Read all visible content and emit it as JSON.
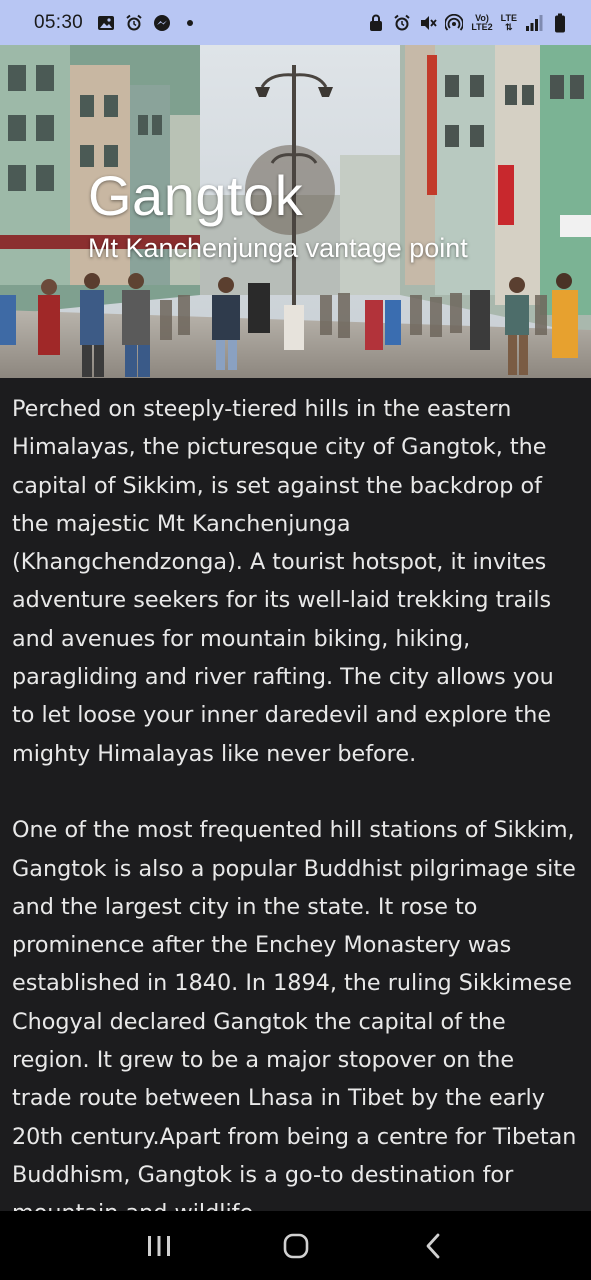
{
  "status_bar": {
    "time": "05:30",
    "left_icons": [
      "image-icon",
      "alarm-icon",
      "messenger-icon",
      "dot-icon"
    ],
    "network_label_top": "Vo)",
    "network_label_bottom": "LTE2",
    "lte_label": "LTE",
    "right_icons": [
      "lock-icon",
      "alarm-icon",
      "mute-icon",
      "hotspot-icon",
      "signal-icon",
      "battery-icon"
    ]
  },
  "hero": {
    "title": "Gangtok",
    "subtitle": "Mt Kanchenjunga vantage point",
    "image": "street-scene-photo"
  },
  "article": {
    "paragraphs": [
      "Perched on steeply-tiered hills in the eastern Himalayas, the picturesque city of Gangtok, the capital of Sikkim, is set against the backdrop of the majestic Mt Kanchenjunga (Khangchendzonga). A tourist hotspot, it invites adventure seekers for its well-laid trekking trails and avenues for mountain biking, hiking, paragliding and river rafting. The city allows you to let loose your inner daredevil and explore the mighty Himalayas like never before.",
      "One of the most frequented hill stations of Sikkim, Gangtok is also a popular Buddhist pilgrimage site and the largest city in the state. It rose to prominence after the Enchey Monastery was established in 1840. In 1894, the ruling Sikkimese Chogyal declared Gangtok the capital of the region. It grew to be a major stopover on the trade route between Lhasa in Tibet by the early 20th century.Apart from being a centre for Tibetan Buddhism, Gangtok is a go-to destination for mountain and wildlife"
    ]
  },
  "nav_bar": {
    "buttons": [
      "recents-icon",
      "home-icon",
      "back-icon"
    ]
  },
  "colors": {
    "status_bar_bg": "#b8c6f3",
    "page_bg": "#1c1c1e",
    "text": "#e8e8e8",
    "nav_bg": "#000000"
  }
}
